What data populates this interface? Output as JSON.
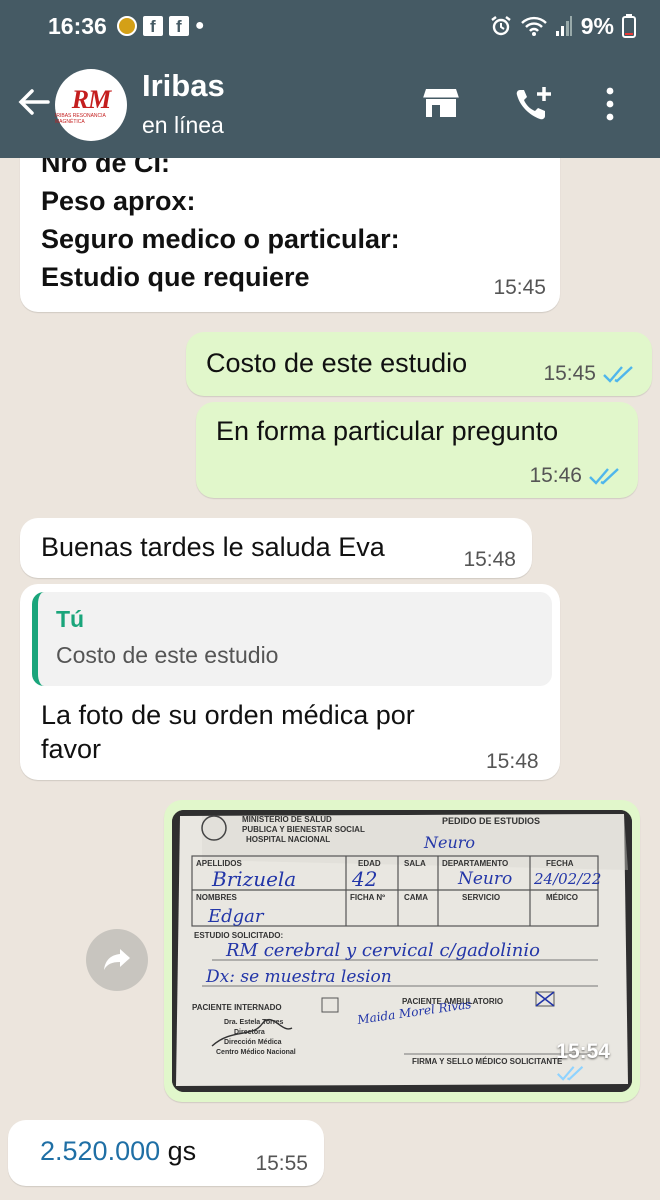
{
  "status_bar": {
    "time": "16:36",
    "icons_left": [
      "coin-icon",
      "facebook-icon",
      "facebook-icon",
      "dot"
    ],
    "icons_right": [
      "alarm-icon",
      "wifi-icon",
      "signal-icon"
    ],
    "battery": "9%"
  },
  "header": {
    "contact_name": "Iribas",
    "presence": "en línea",
    "avatar_logo": "RM",
    "avatar_logo_sub": "IRIBAS RESONANCIA MAGNÉTICA"
  },
  "messages": {
    "m1": {
      "lines": [
        "Nro de CI:",
        "Peso aprox:",
        "Seguro medico o particular:",
        "Estudio que requiere"
      ],
      "time": "15:45"
    },
    "m2": {
      "text": "Costo de este estudio",
      "time": "15:45"
    },
    "m3": {
      "text": "En forma particular pregunto",
      "time": "15:46"
    },
    "m4": {
      "text": "Buenas tardes le saluda Eva",
      "time": "15:48"
    },
    "m5": {
      "quote_author": "Tú",
      "quote_text": "Costo de este estudio",
      "lines": [
        "La foto de su orden médica por",
        "favor"
      ],
      "time": "15:48"
    },
    "m6": {
      "time": "15:54",
      "form": {
        "ministry": "MINISTERIO DE SALUD",
        "ministry2": "PUBLICA Y BIENESTAR SOCIAL",
        "hospital": "HOSPITAL NACIONAL",
        "title": "PEDIDO DE ESTUDIOS",
        "col_apellidos": "APELLIDOS",
        "col_edad": "EDAD",
        "col_sala": "SALA",
        "col_departamento": "DEPARTAMENTO",
        "col_fecha": "FECHA",
        "col_nombres": "NOMBRES",
        "col_ficha": "FICHA Nº",
        "col_cama": "CAMA",
        "col_servicio": "SERVICIO",
        "col_medico": "MÉDICO",
        "estudio_solicitado": "ESTUDIO SOLICITADO:",
        "paciente_internado": "PACIENTE INTERNADO",
        "paciente_ambulatorio": "PACIENTE AMBULATORIO",
        "firma": "FIRMA Y SELLO MÉDICO SOLICITANTE",
        "stamp1": "Dra. Estela Torres",
        "stamp2": "Directora",
        "stamp3": "Dirección Médica",
        "stamp4": "Centro Médico Nacional",
        "hw_apellido": "Brizuela",
        "hw_edad": "42",
        "hw_nombre": "Edgar",
        "hw_fecha": "24/02/22",
        "hw_depto": "Neuro",
        "hw_estudio": "RM cerebral y cervical c/gadolinio",
        "hw_dx": "Dx: se muestra lesion",
        "hw_signature": "Maida Morel Rivas"
      }
    },
    "m7": {
      "amount": "2.520.000",
      "unit": "gs",
      "time": "15:55"
    }
  },
  "colors": {
    "header": "#455a64",
    "chat_bg": "#ece5dd",
    "incoming": "#ffffff",
    "outgoing": "#e1f7cb",
    "read_ticks": "#4fb6ec",
    "quote_accent": "#1aa57b",
    "link_number": "#1f6fa5"
  }
}
